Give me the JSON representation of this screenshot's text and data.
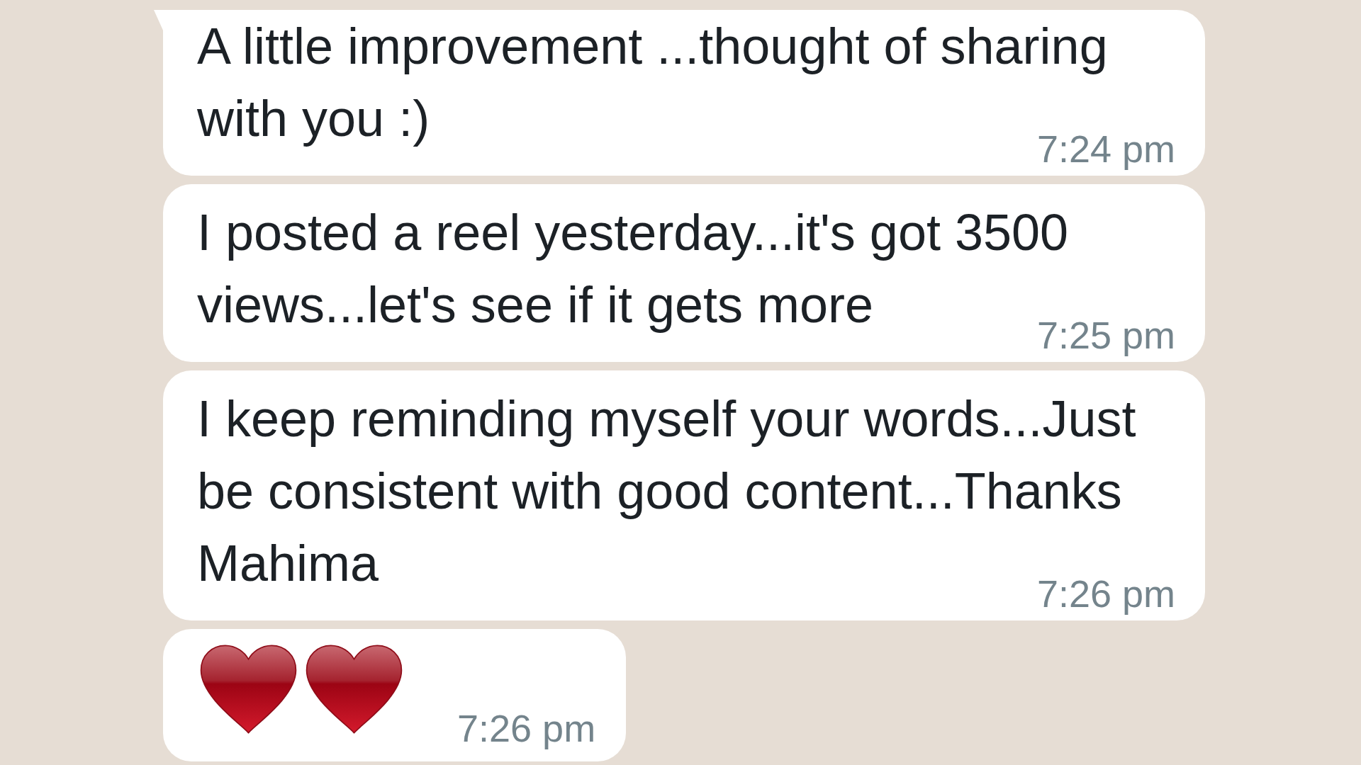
{
  "messages": [
    {
      "kind": "text",
      "text": "A little improvement ...thought of sharing with you :)",
      "time": "7:24 pm",
      "tail": true
    },
    {
      "kind": "text",
      "text": "I posted a reel yesterday...it's got 3500 views...let's see if it gets more",
      "time": "7:25 pm",
      "tail": false
    },
    {
      "kind": "text",
      "text": "I keep reminding myself your words...Just be consistent with good content...Thanks Mahima",
      "time": "7:26 pm",
      "tail": false
    },
    {
      "kind": "emoji",
      "emojis": [
        {
          "kind": "heart"
        },
        {
          "kind": "heart"
        }
      ],
      "time": "7:26 pm",
      "tail": false
    }
  ]
}
